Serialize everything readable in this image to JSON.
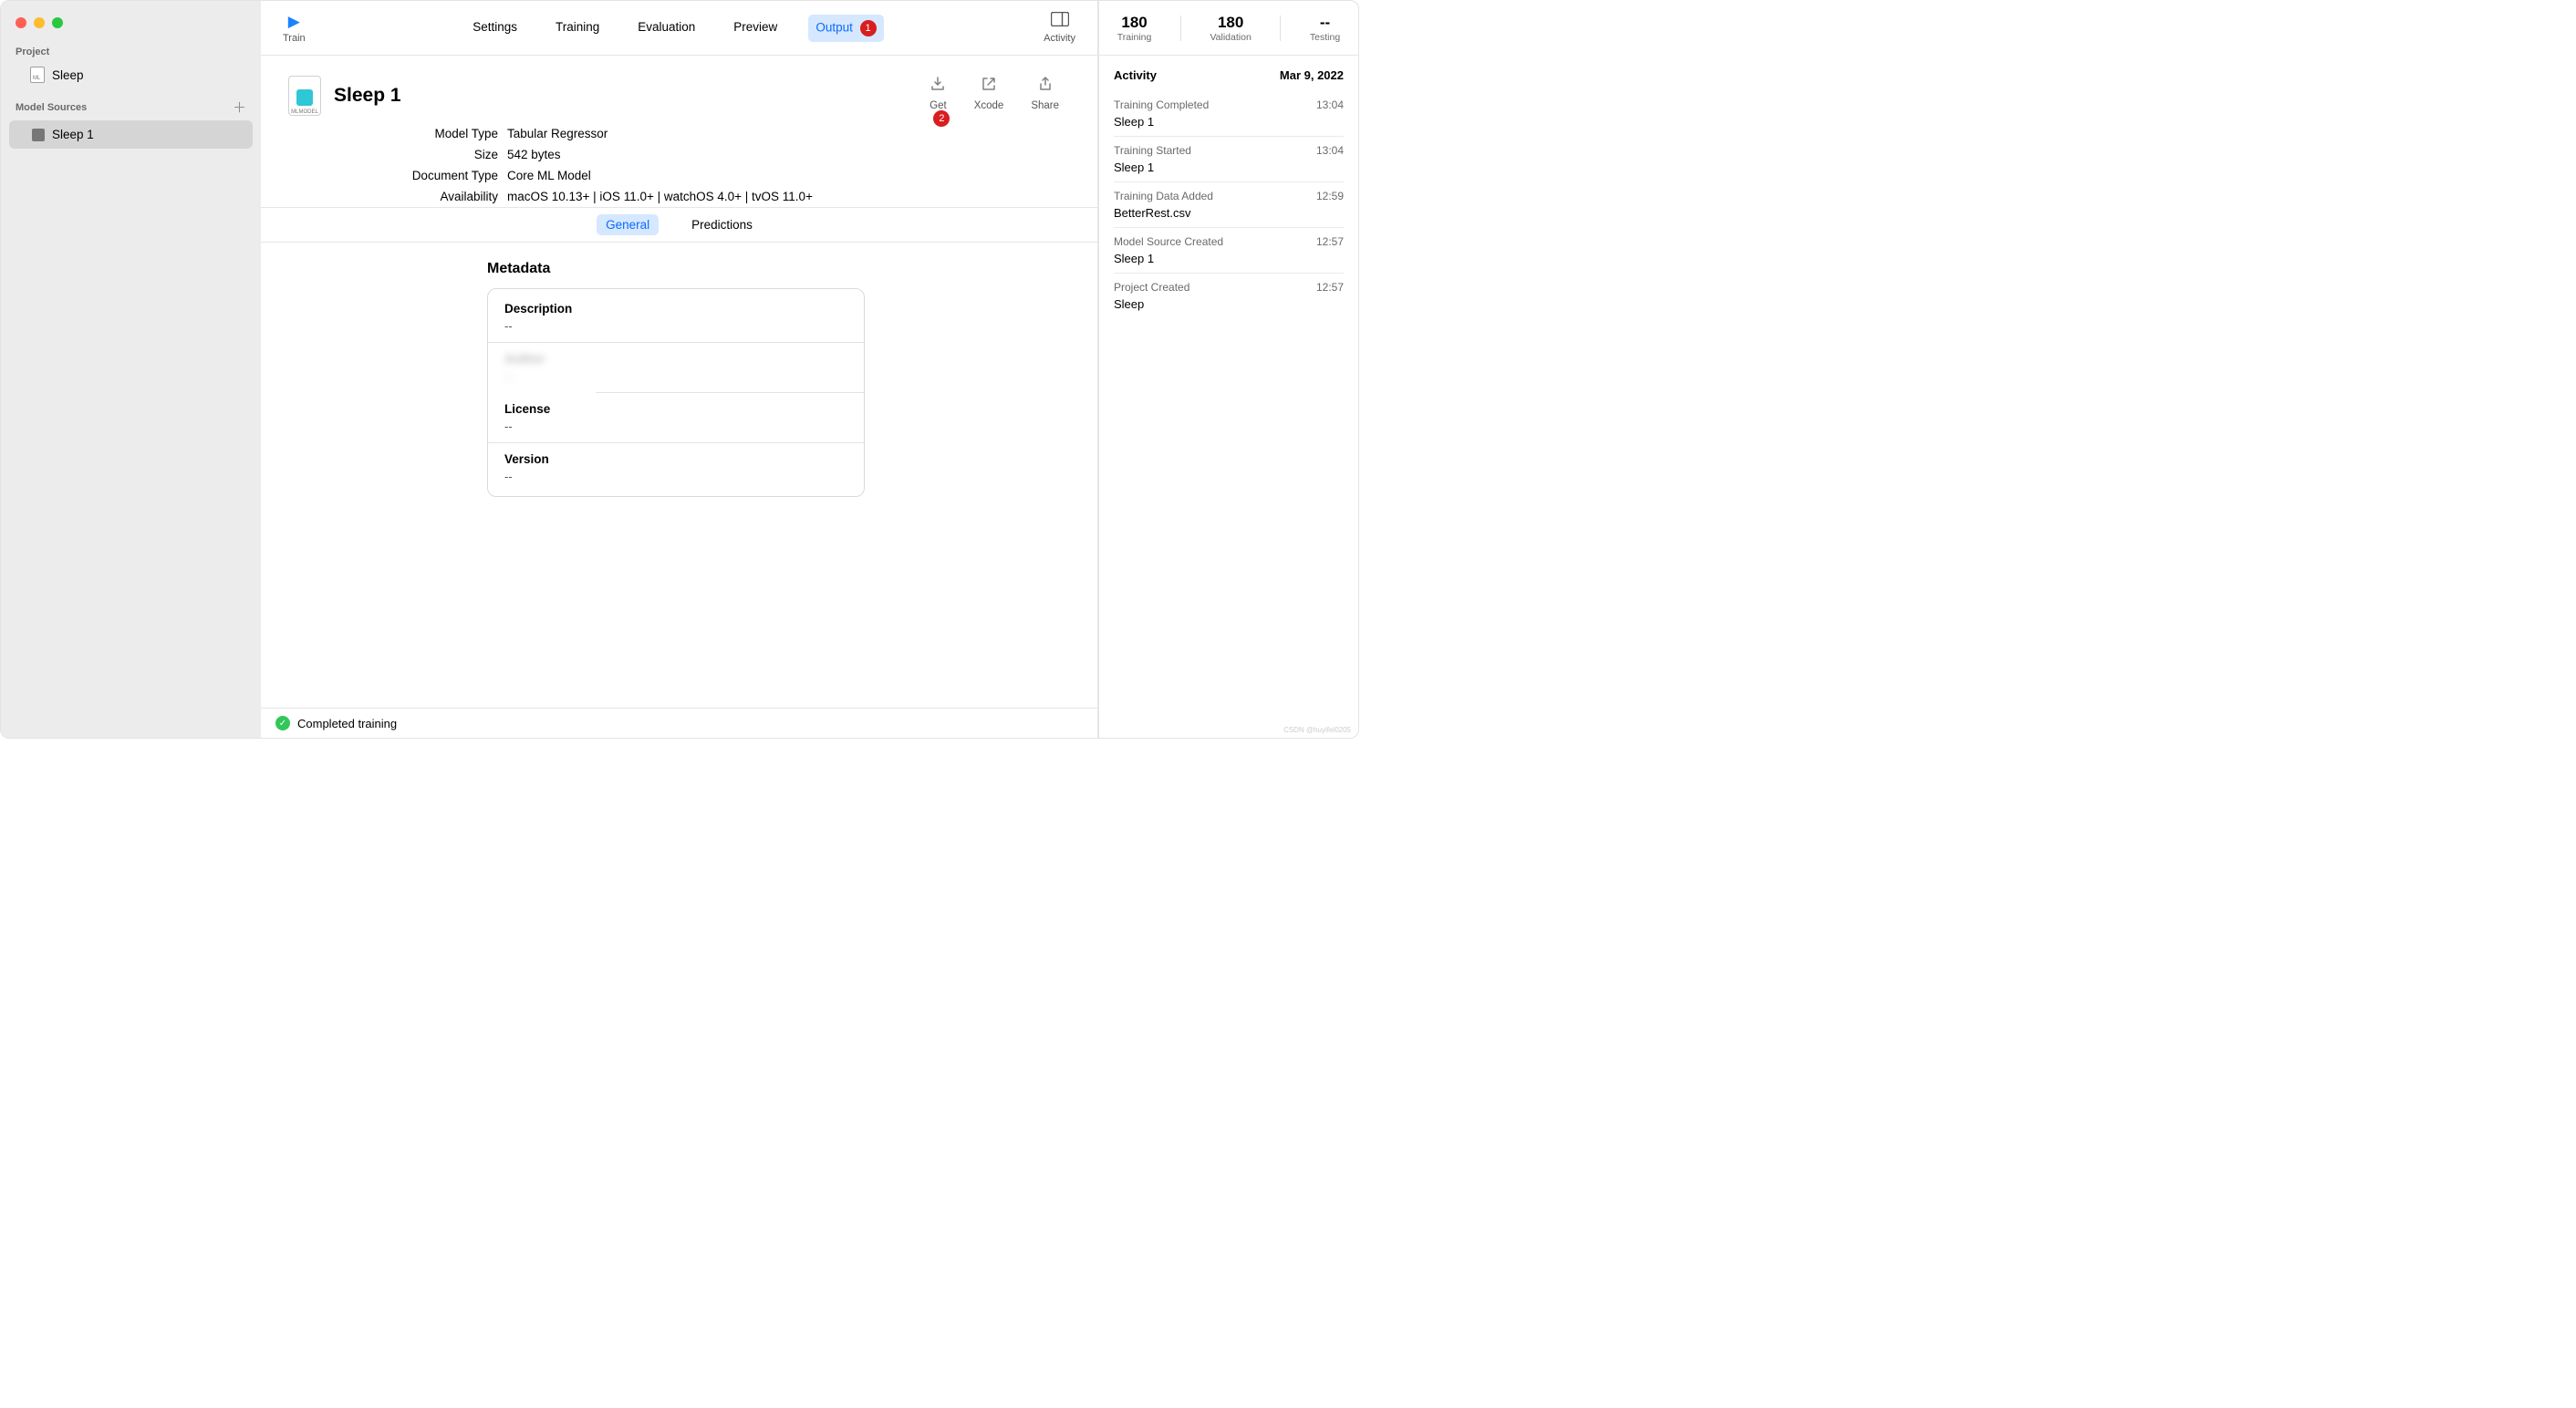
{
  "sidebar": {
    "project_label": "Project",
    "project_name": "Sleep",
    "sources_label": "Model Sources",
    "items": [
      "Sleep 1"
    ]
  },
  "toolbar": {
    "train_label": "Train",
    "tabs": [
      "Settings",
      "Training",
      "Evaluation",
      "Preview",
      "Output"
    ],
    "active_tab": "Output",
    "activity_label": "Activity",
    "badge1": "1"
  },
  "header": {
    "title": "Sleep 1",
    "actions": {
      "get": "Get",
      "xcode": "Xcode",
      "share": "Share"
    },
    "badge2": "2"
  },
  "props": {
    "model_type_label": "Model Type",
    "model_type": "Tabular Regressor",
    "size_label": "Size",
    "size": "542 bytes",
    "doc_type_label": "Document Type",
    "doc_type": "Core ML Model",
    "availability_label": "Availability",
    "availability": "macOS 10.13+  |  iOS 11.0+  |  watchOS 4.0+  |  tvOS 11.0+"
  },
  "segment": {
    "general": "General",
    "predictions": "Predictions"
  },
  "metadata": {
    "title": "Metadata",
    "description_label": "Description",
    "description_value": "--",
    "author_label": "Author",
    "author_value": "--",
    "license_label": "License",
    "license_value": "--",
    "version_label": "Version",
    "version_value": "--"
  },
  "status": {
    "text": "Completed training"
  },
  "metrics": {
    "training_num": "180",
    "training_label": "Training",
    "validation_num": "180",
    "validation_label": "Validation",
    "testing_num": "--",
    "testing_label": "Testing"
  },
  "activity": {
    "heading": "Activity",
    "date": "Mar 9, 2022",
    "log": [
      {
        "title": "Training Completed",
        "time": "13:04",
        "sub": "Sleep 1"
      },
      {
        "title": "Training Started",
        "time": "13:04",
        "sub": "Sleep 1"
      },
      {
        "title": "Training Data Added",
        "time": "12:59",
        "sub": "BetterRest.csv"
      },
      {
        "title": "Model Source Created",
        "time": "12:57",
        "sub": "Sleep 1"
      },
      {
        "title": "Project Created",
        "time": "12:57",
        "sub": "Sleep"
      }
    ]
  },
  "watermark": "CSDN @huyifei0205"
}
